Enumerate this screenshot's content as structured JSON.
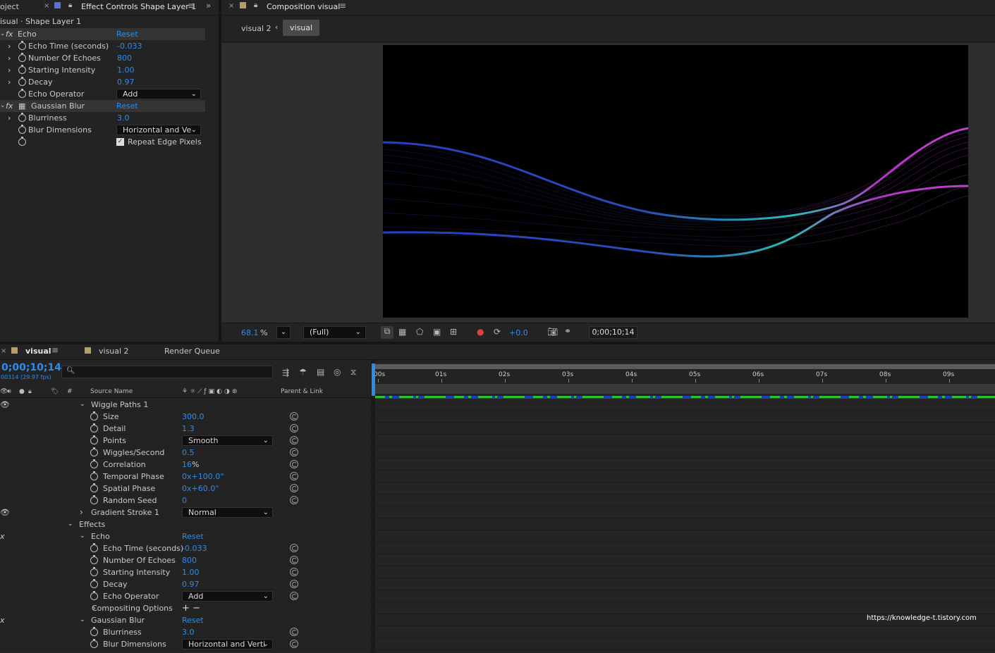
{
  "effect_panel": {
    "project_tab_fragment": "oject",
    "tab_title": "Effect Controls Shape Layer 1",
    "layer_path": "isual · Shape Layer 1",
    "rows": [
      {
        "label": "Echo",
        "value": "Reset",
        "type": "effect"
      },
      {
        "label": "Echo Time (seconds)",
        "value": "-0.033",
        "type": "prop"
      },
      {
        "label": "Number Of Echoes",
        "value": "800",
        "type": "prop"
      },
      {
        "label": "Starting Intensity",
        "value": "1.00",
        "type": "prop"
      },
      {
        "label": "Decay",
        "value": "0.97",
        "type": "prop"
      },
      {
        "label": "Echo Operator",
        "value": "Add",
        "type": "dropdown"
      },
      {
        "label": "Gaussian Blur",
        "value": "Reset",
        "type": "effect"
      },
      {
        "label": "Blurriness",
        "value": "3.0",
        "type": "prop"
      },
      {
        "label": "Blur Dimensions",
        "value": "Horizontal and Ve",
        "type": "dropdown"
      },
      {
        "label": "",
        "value": "Repeat Edge Pixels",
        "type": "checkbox"
      }
    ]
  },
  "composition": {
    "tab_title": "Composition visual",
    "breadcrumb": [
      "visual 2",
      "visual"
    ],
    "zoom": "68.1",
    "zoom_unit": "%",
    "resolution": "(Full)",
    "exposure": "+0.0",
    "timecode": "0;00;10;14"
  },
  "timeline": {
    "tabs": [
      "visual",
      "visual 2",
      "Render Queue"
    ],
    "timecode": "0;00;10;14",
    "frame_info": "00314 (29.97 fps)",
    "search_placeholder": "",
    "col_source": "Source Name",
    "col_parent": "Parent & Link",
    "hash": "#",
    "ticks": [
      ":00s",
      "01s",
      "02s",
      "03s",
      "04s",
      "05s",
      "06s",
      "07s",
      "08s",
      "09s"
    ],
    "rows": [
      {
        "label": "Wiggle Paths 1",
        "value": "",
        "indent": 1,
        "chev": "down",
        "type": "group"
      },
      {
        "label": "Size",
        "value": "300.0",
        "indent": 2,
        "type": "prop"
      },
      {
        "label": "Detail",
        "value": "1.3",
        "indent": 2,
        "type": "prop"
      },
      {
        "label": "Points",
        "value": "Smooth",
        "indent": 2,
        "type": "dropdown"
      },
      {
        "label": "Wiggles/Second",
        "value": "0.5",
        "indent": 2,
        "type": "prop"
      },
      {
        "label": "Correlation",
        "value": "16",
        "suffix": "%",
        "indent": 2,
        "type": "prop"
      },
      {
        "label": "Temporal Phase",
        "value": "0x+100.0°",
        "indent": 2,
        "type": "prop"
      },
      {
        "label": "Spatial Phase",
        "value": "0x+60.0°",
        "indent": 2,
        "type": "prop"
      },
      {
        "label": "Random Seed",
        "value": "0",
        "indent": 2,
        "type": "prop"
      },
      {
        "label": "Gradient Stroke 1",
        "value": "Normal",
        "indent": 1,
        "chev": "right",
        "type": "groupdd"
      },
      {
        "label": "Effects",
        "value": "",
        "indent": 0,
        "chev": "down",
        "type": "group"
      },
      {
        "label": "Echo",
        "value": "Reset",
        "indent": 1,
        "chev": "down",
        "type": "effect"
      },
      {
        "label": "Echo Time (seconds)",
        "value": "-0.033",
        "indent": 2,
        "type": "prop"
      },
      {
        "label": "Number Of Echoes",
        "value": "800",
        "indent": 2,
        "type": "prop"
      },
      {
        "label": "Starting Intensity",
        "value": "1.00",
        "indent": 2,
        "type": "prop"
      },
      {
        "label": "Decay",
        "value": "0.97",
        "indent": 2,
        "type": "prop"
      },
      {
        "label": "Echo Operator",
        "value": "Add",
        "indent": 2,
        "type": "dropdown"
      },
      {
        "label": "Compositing Options",
        "value": "+ −",
        "indent": 2,
        "chev": "right",
        "type": "compo"
      },
      {
        "label": "Gaussian Blur",
        "value": "Reset",
        "indent": 1,
        "chev": "down",
        "type": "effect"
      },
      {
        "label": "Blurriness",
        "value": "3.0",
        "indent": 2,
        "type": "prop"
      },
      {
        "label": "Blur Dimensions",
        "value": "Horizontal and Verti",
        "indent": 2,
        "type": "dropdown"
      }
    ]
  },
  "watermark": "https://knowledge-t.tistory.com",
  "colors": {
    "accent_blue": "#2d8ceb",
    "panel_bg": "#232323",
    "viewer_bg": "#000000",
    "timeline_green": "#2cc12c"
  }
}
